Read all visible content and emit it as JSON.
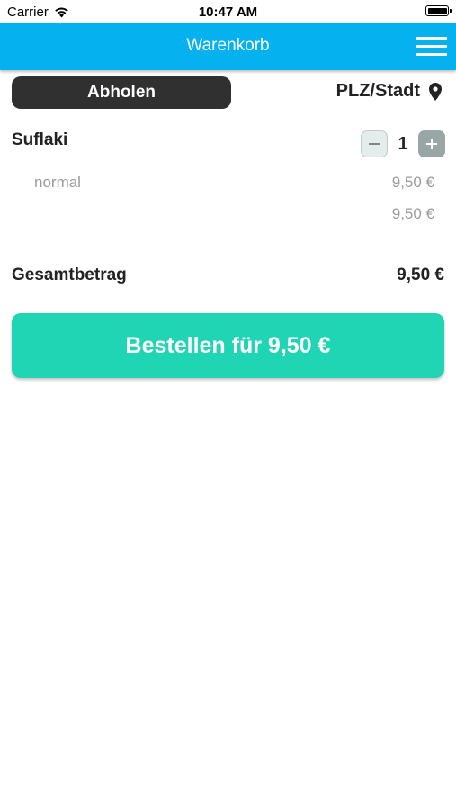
{
  "status_bar": {
    "carrier": "Carrier",
    "time": "10:47 AM",
    "icons": [
      "wifi-icon",
      "battery-icon"
    ]
  },
  "navbar": {
    "title": "Warenkorb",
    "menu_icon": "hamburger-menu-icon",
    "background_color": "#05b1ef"
  },
  "delivery": {
    "pickup_label": "Abholen",
    "location_label": "PLZ/Stadt",
    "location_icon": "map-pin-icon"
  },
  "cart": {
    "items": [
      {
        "name": "Suflaki",
        "quantity": "1",
        "variant": "normal",
        "variant_price": "9,50 €",
        "total": "9,50 €"
      }
    ],
    "total_label": "Gesamtbetrag",
    "total_value": "9,50 €"
  },
  "order_button": {
    "label": "Bestellen für 9,50 €",
    "color": "#1fd5b3"
  }
}
